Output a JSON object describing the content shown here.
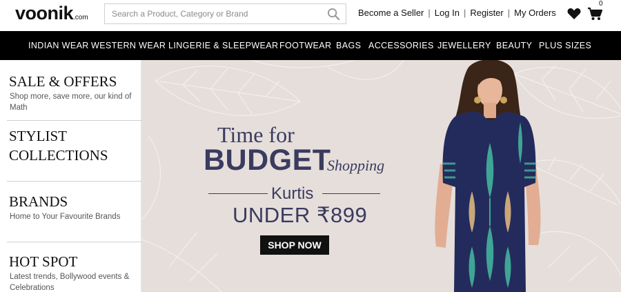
{
  "header": {
    "logo": "voonik",
    "logo_suffix": ".com",
    "search_placeholder": "Search a Product, Category or Brand",
    "links": [
      "Become a Seller",
      "Log In",
      "Register",
      "My Orders"
    ],
    "cart_count": "0"
  },
  "nav": {
    "items": [
      "INDIAN WEAR",
      "WESTERN WEAR",
      "LINGERIE & SLEEPWEAR",
      "FOOTWEAR",
      "BAGS",
      "ACCESSORIES",
      "JEWELLERY",
      "BEAUTY",
      "PLUS SIZES"
    ]
  },
  "sidebar": {
    "items": [
      {
        "title": "SALE & OFFERS",
        "subtitle": "Shop more, save more, our kind of Math"
      },
      {
        "title": "STYLIST COLLECTIONS",
        "subtitle": ""
      },
      {
        "title": "BRANDS",
        "subtitle": "Home to Your Favourite Brands"
      },
      {
        "title": "HOT SPOT",
        "subtitle": "Latest trends, Bollywood events & Celebrations"
      }
    ]
  },
  "banner": {
    "line1": "Time for",
    "line2": "BUDGET",
    "line2_suffix": "Shopping",
    "line3": "Kurtis",
    "line4": "UNDER ₹899",
    "cta": "SHOP NOW"
  },
  "colors": {
    "nav_bg": "#000000",
    "banner_bg": "#e5dedb",
    "banner_text": "#3a3b5e",
    "kurta": "#232b5c"
  }
}
